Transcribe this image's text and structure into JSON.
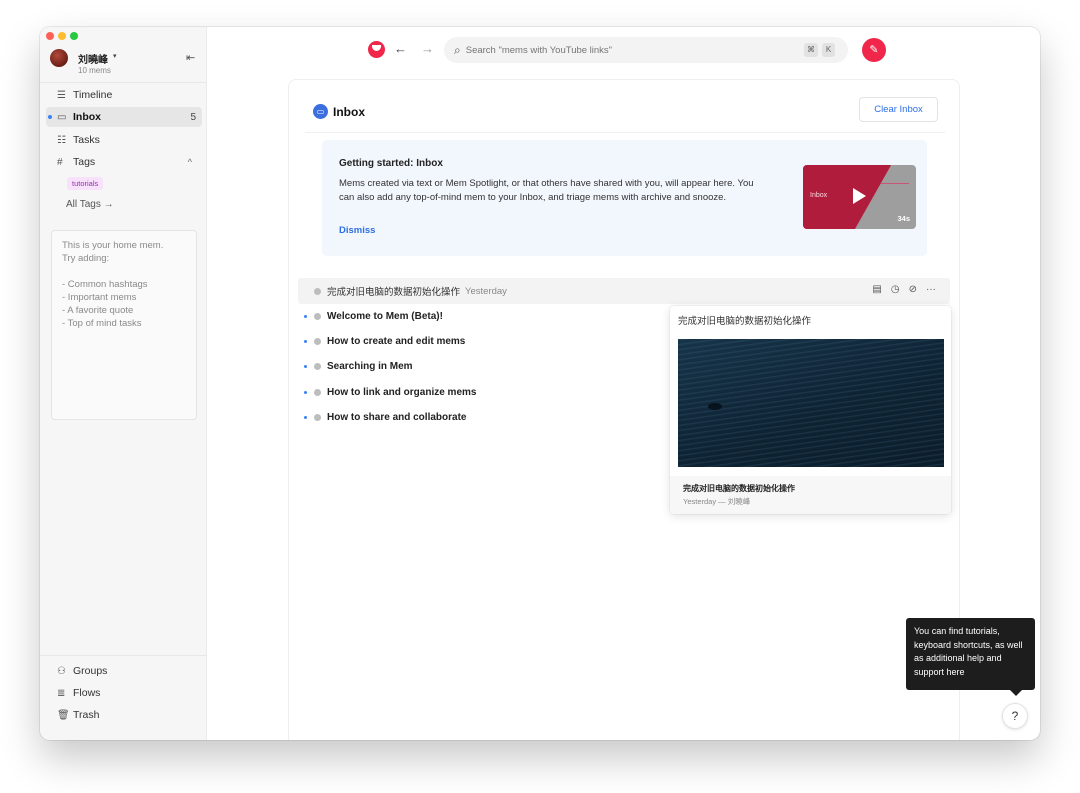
{
  "user": {
    "name": "刘曉峰",
    "caret": "▾",
    "mem_count": "10 mems"
  },
  "sidebar": {
    "collapse_icon": "collapse-left-icon",
    "items": [
      {
        "label": "Timeline",
        "icon": "timeline-icon"
      },
      {
        "label": "Inbox",
        "icon": "inbox-icon",
        "badge": "5",
        "active": true
      },
      {
        "label": "Tasks",
        "icon": "tasks-icon"
      },
      {
        "label": "Tags",
        "icon": "hash-icon",
        "caret": "^"
      }
    ],
    "tag_chip": "tutorials",
    "all_tags": "All Tags →",
    "home_mem": {
      "line1": "This is your home mem.",
      "line2": "Try adding:",
      "bullets": [
        "- Common hashtags",
        "- Important mems",
        "- A favorite quote",
        "- Top of mind tasks"
      ]
    },
    "bottom": [
      {
        "label": "Groups",
        "icon": "groups-icon"
      },
      {
        "label": "Flows",
        "icon": "flows-icon"
      },
      {
        "label": "Trash",
        "icon": "trash-icon"
      }
    ]
  },
  "topbar": {
    "back": "←",
    "forward": "→",
    "search_placeholder": "Search \"mems with YouTube links\"",
    "shortcut_keys": [
      "⌘",
      "K"
    ],
    "compose_icon": "compose-icon"
  },
  "inbox": {
    "title": "Inbox",
    "clear_button": "Clear Inbox",
    "getting_started": {
      "title": "Getting started: Inbox",
      "body": "Mems created via text or Mem Spotlight, or that others have shared with you, will appear here. You can also add any top-of-mind mem to your Inbox, and triage mems with archive and snooze.",
      "dismiss": "Dismiss",
      "video_label": "Inbox",
      "video_duration": "34s"
    }
  },
  "group": {
    "title": "完成对旧电脑的数据初始化操作",
    "time": "Yesterday",
    "actions": [
      "archive-icon",
      "snooze-icon",
      "pin-icon",
      "more-icon"
    ]
  },
  "mems": [
    "Welcome to Mem (Beta)!",
    "How to create and edit mems",
    "Searching in Mem",
    "How to link and organize mems",
    "How to share and collaborate"
  ],
  "preview": {
    "title": "完成对旧电脑的数据初始化操作",
    "footer_title": "完成对旧电脑的数据初始化操作",
    "footer_meta": "Yesterday — 刘曉峰"
  },
  "help": {
    "tooltip": "You can find tutorials, keyboard shortcuts, as well as additional help and support here",
    "button": "?"
  },
  "colors": {
    "accent": "#f0264b",
    "link": "#2f6fe4",
    "tag_bg": "#f7e1fb",
    "tag_fg": "#9a2fb3"
  }
}
